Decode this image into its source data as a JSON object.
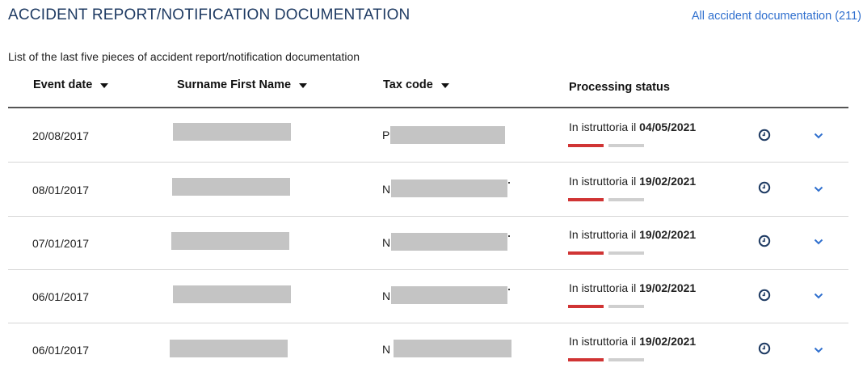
{
  "header": {
    "title": "ACCIDENT REPORT/NOTIFICATION DOCUMENTATION",
    "all_link": "All accident documentation (211)"
  },
  "subtitle": "List of the last five pieces of accident report/notification documentation",
  "columns": {
    "event_date": "Event date",
    "name": "Surname First Name",
    "tax_code": "Tax code",
    "status": "Processing status"
  },
  "rows": [
    {
      "date": "20/08/2017",
      "tax_prefix": "P",
      "status_prefix": "In istruttoria il",
      "status_date": "04/05/2021"
    },
    {
      "date": "08/01/2017",
      "tax_prefix": "N",
      "status_prefix": "In istruttoria il",
      "status_date": "19/02/2021"
    },
    {
      "date": "07/01/2017",
      "tax_prefix": "N",
      "status_prefix": "In istruttoria il",
      "status_date": "19/02/2021"
    },
    {
      "date": "06/01/2017",
      "tax_prefix": "N",
      "status_prefix": "In istruttoria il",
      "status_date": "19/02/2021"
    },
    {
      "date": "06/01/2017",
      "tax_prefix": "N",
      "status_prefix": "In istruttoria il",
      "status_date": "19/02/2021"
    }
  ],
  "colors": {
    "title": "#1f3b63",
    "link": "#2f6fce",
    "progress_active": "#d03434",
    "progress_inactive": "#cfcfcf",
    "icon": "#1f3b63",
    "chevron": "#2f6fce"
  },
  "icons": {
    "sort": "caret-down-icon",
    "history": "clock-icon",
    "expand": "chevron-down-icon"
  }
}
